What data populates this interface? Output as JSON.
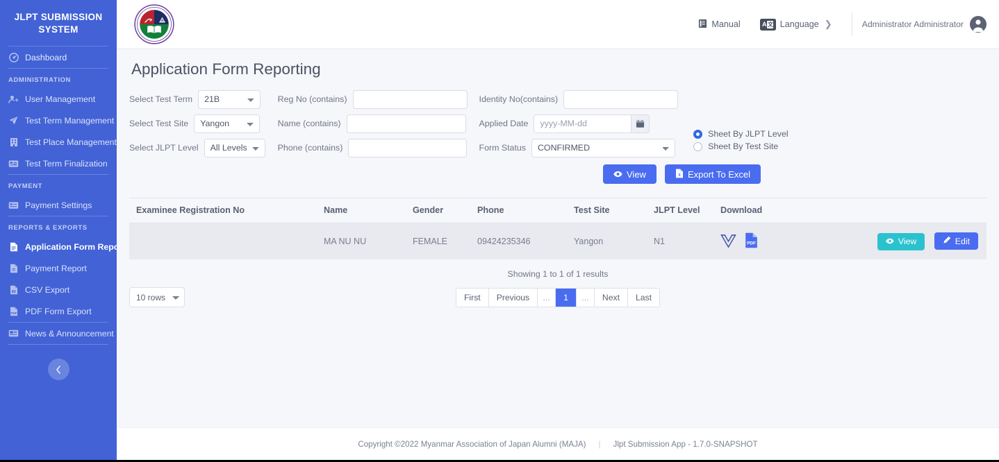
{
  "sidebar": {
    "brand": "JLPT SUBMISSION SYSTEM",
    "dashboard": {
      "label": "Dashboard",
      "icon": "dashboard-icon"
    },
    "groups": [
      {
        "label": "ADMINISTRATION",
        "items": [
          {
            "label": "User Management",
            "icon": "user-plus-icon"
          },
          {
            "label": "Test Term Management",
            "icon": "paper-plane-icon"
          },
          {
            "label": "Test Place Management",
            "icon": "building-icon"
          },
          {
            "label": "Test Term Finalization",
            "icon": "id-card-icon"
          }
        ]
      },
      {
        "label": "PAYMENT",
        "items": [
          {
            "label": "Payment Settings",
            "icon": "credit-card-icon"
          }
        ]
      },
      {
        "label": "REPORTS & EXPORTS",
        "items": [
          {
            "label": "Application Form Report",
            "icon": "file-text-icon",
            "active": true
          },
          {
            "label": "Payment Report",
            "icon": "file-icon"
          },
          {
            "label": "CSV Export",
            "icon": "file-csv-icon"
          },
          {
            "label": "PDF Form Export",
            "icon": "file-pdf-icon"
          }
        ]
      },
      {
        "label": "",
        "items": [
          {
            "label": "News & Announcement",
            "icon": "newspaper-icon"
          }
        ]
      }
    ],
    "collapse_icon": "chevron-left-icon",
    "accent_color": "#4262d6"
  },
  "topbar": {
    "logo_name": "maja-seal-logo",
    "manual": {
      "label": "Manual",
      "icon": "book-icon"
    },
    "language": {
      "label": "Language",
      "icon": "translate-icon",
      "chevron": "chevron-right-icon"
    },
    "user": {
      "name": "Administrator Administrator",
      "icon": "user-avatar-icon"
    }
  },
  "page": {
    "title": "Application Form Reporting"
  },
  "filters": {
    "test_term": {
      "label": "Select Test Term",
      "value": "21B",
      "options": [
        "21B"
      ]
    },
    "test_site": {
      "label": "Select Test Site",
      "value": "Yangon",
      "options": [
        "Yangon"
      ]
    },
    "jlpt_level": {
      "label": "Select JLPT Level",
      "value": "All Levels",
      "options": [
        "All Levels"
      ]
    },
    "reg_no": {
      "label": "Reg No (contains)",
      "value": "",
      "placeholder": ""
    },
    "name": {
      "label": "Name (contains)",
      "value": "",
      "placeholder": ""
    },
    "phone": {
      "label": "Phone (contains)",
      "value": "",
      "placeholder": ""
    },
    "identity_no": {
      "label": "Identity No(contains)",
      "value": "",
      "placeholder": ""
    },
    "applied_date": {
      "label": "Applied Date",
      "value": "",
      "placeholder": "yyyy-MM-dd",
      "icon": "calendar-icon"
    },
    "form_status": {
      "label": "Form Status",
      "value": "CONFIRMED",
      "options": [
        "CONFIRMED"
      ]
    },
    "sheet_mode": {
      "selected": "Sheet By JLPT Level",
      "options": [
        "Sheet By JLPT Level",
        "Sheet By Test Site"
      ]
    },
    "view_button": {
      "label": "View",
      "icon": "eye-icon"
    },
    "export_button": {
      "label": "Export To Excel",
      "icon": "file-excel-icon"
    }
  },
  "table": {
    "columns": [
      "Examinee Registration No",
      "Name",
      "Gender",
      "Phone",
      "Test Site",
      "JLPT Level",
      "Download",
      ""
    ],
    "rows": [
      {
        "registration_no": "",
        "name": "MA NU NU",
        "gender": "FEMALE",
        "phone": "09424235346",
        "test_site": "Yangon",
        "jlpt_level": "N1",
        "downloads": [
          {
            "icon": "v-form-icon",
            "color": "#3b4ea8"
          },
          {
            "icon": "file-pdf-icon",
            "color": "#4a6cf0"
          }
        ],
        "view_button": {
          "label": "View",
          "icon": "eye-icon"
        },
        "edit_button": {
          "label": "Edit",
          "icon": "pencil-icon"
        }
      }
    ]
  },
  "pagination": {
    "showing": "Showing 1 to 1 of 1 results",
    "rows_per_page": {
      "value": "10 rows",
      "options": [
        "10 rows"
      ]
    },
    "buttons": [
      {
        "label": "First",
        "active": false
      },
      {
        "label": "Previous",
        "active": false
      },
      {
        "label": "...",
        "active": false,
        "dots": true
      },
      {
        "label": "1",
        "active": true
      },
      {
        "label": "...",
        "active": false,
        "dots": true
      },
      {
        "label": "Next",
        "active": false
      },
      {
        "label": "Last",
        "active": false
      }
    ]
  },
  "footer": {
    "copyright": "Copyright ©2022 Myanmar Association of Japan Alumni (MAJA)",
    "separator": "|",
    "app_version": "Jlpt Submission App - 1.7.0-SNAPSHOT"
  }
}
